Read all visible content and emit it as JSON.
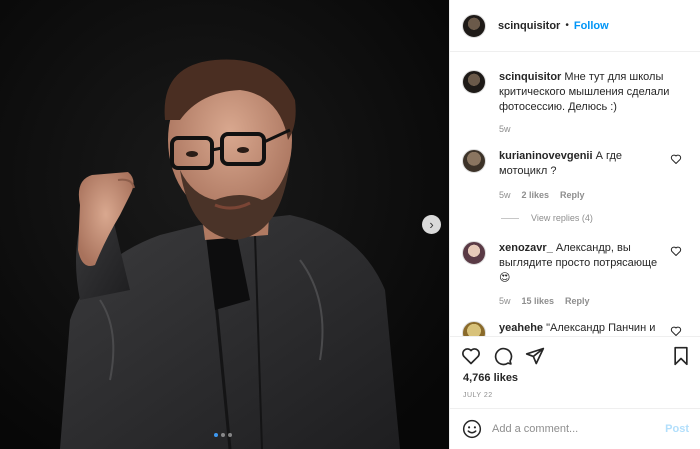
{
  "header": {
    "username": "scinquisitor",
    "separator": "•",
    "follow_label": "Follow"
  },
  "caption": {
    "username": "scinquisitor",
    "text": "Мне тут для школы критического мышления сделали фотосессию. Делюсь :)",
    "time": "5w"
  },
  "comments": [
    {
      "username": "kurianinovevgenii",
      "text": "А где мотоцикл ?",
      "time": "5w",
      "likes": "2 likes",
      "reply_label": "Reply",
      "view_replies": "View replies (4)"
    },
    {
      "username": "xenozavr_",
      "text": "Александр, вы выглядите просто потрясающе 😍",
      "time": "5w",
      "likes": "15 likes",
      "reply_label": "Reply"
    },
    {
      "username": "yeahehe",
      "text": "\"Александр Панчин и"
    }
  ],
  "actions": {
    "icons": [
      "heart-icon",
      "comment-icon",
      "share-icon",
      "bookmark-icon"
    ],
    "likes": "4,766 likes",
    "date": "JULY 22"
  },
  "add_comment": {
    "placeholder": "Add a comment...",
    "post_label": "Post"
  },
  "carousel": {
    "next_icon": "chevron-right-icon",
    "slide_count": 3,
    "active_slide": 1
  },
  "colors": {
    "accent": "#0095f6",
    "post_disabled": "#b2dffc",
    "photo_background": "#0c0c0c"
  }
}
